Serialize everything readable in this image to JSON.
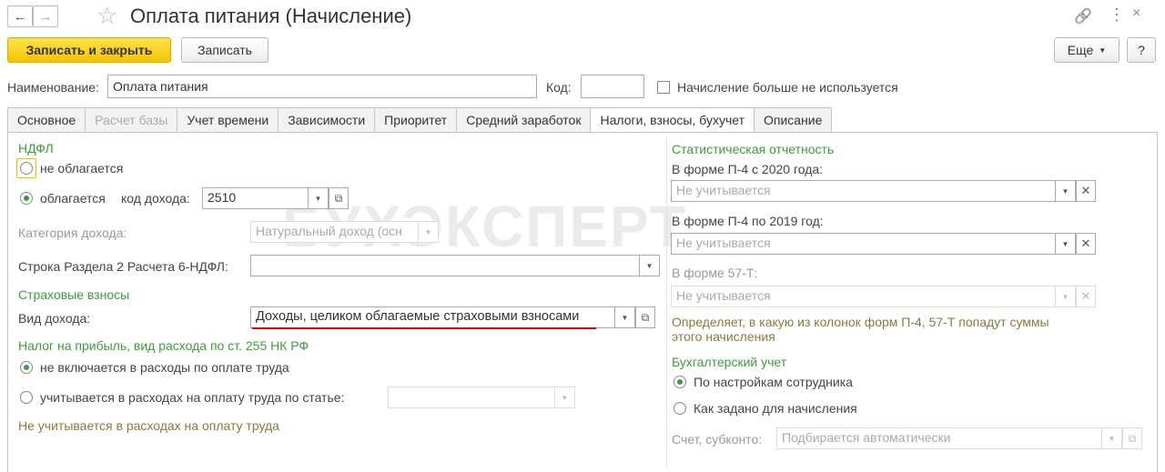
{
  "header": {
    "title": "Оплата питания (Начисление)",
    "back_icon": "←",
    "forward_icon": "→",
    "star_icon": "☆",
    "link_icon": "🔗",
    "more_icon": "⋮",
    "close_icon": "×"
  },
  "toolbar": {
    "save_close": "Записать и закрыть",
    "save": "Записать",
    "more": "Еще",
    "help": "?"
  },
  "form": {
    "name_label": "Наименование:",
    "name_value": "Оплата питания",
    "code_label": "Код:",
    "code_value": "",
    "unused_label": "Начисление больше не используется"
  },
  "tabs": [
    {
      "label": "Основное"
    },
    {
      "label": "Расчет базы"
    },
    {
      "label": "Учет времени"
    },
    {
      "label": "Зависимости"
    },
    {
      "label": "Приоритет"
    },
    {
      "label": "Средний заработок"
    },
    {
      "label": "Налоги, взносы, бухучет"
    },
    {
      "label": "Описание"
    }
  ],
  "left": {
    "ndfl_title": "НДФЛ",
    "not_taxed": "не облагается",
    "taxed": "облагается",
    "income_code_label": "код дохода:",
    "income_code": "2510",
    "income_category_label": "Категория дохода:",
    "income_category": "Натуральный доход (осн",
    "line_6ndfl_label": "Строка Раздела 2 Расчета 6-НДФЛ:",
    "line_6ndfl_value": "",
    "insurance_title": "Страховые взносы",
    "income_type_label": "Вид дохода:",
    "income_type": "Доходы, целиком облагаемые страховыми взносами",
    "profit_tax_title": "Налог на прибыль, вид расхода по ст. 255 НК РФ",
    "not_included": "не включается в расходы по оплате труда",
    "included_article": "учитывается в расходах на оплату труда по статье:",
    "note": "Не учитывается в расходах на оплату труда"
  },
  "right": {
    "stat_title": "Статистическая отчетность",
    "p4_2020_label": "В форме П-4 с 2020 года:",
    "p4_2020_value": "Не учитывается",
    "p4_2019_label": "В форме П-4 по 2019 год:",
    "p4_2019_value": "Не учитывается",
    "f57t_label": "В форме 57-Т:",
    "f57t_value": "Не учитывается",
    "stat_note_1": "Определяет, в какую из колонок форм П-4, 57-Т попадут суммы",
    "stat_note_2": "этого начисления",
    "acct_title": "Бухгалтерский учет",
    "by_employee": "По настройкам сотрудника",
    "as_set": "Как задано для начисления",
    "account_label": "Счет, субконто:",
    "account_value": "Подбирается автоматически"
  },
  "watermark": "БУХЭКСПЕРТ"
}
